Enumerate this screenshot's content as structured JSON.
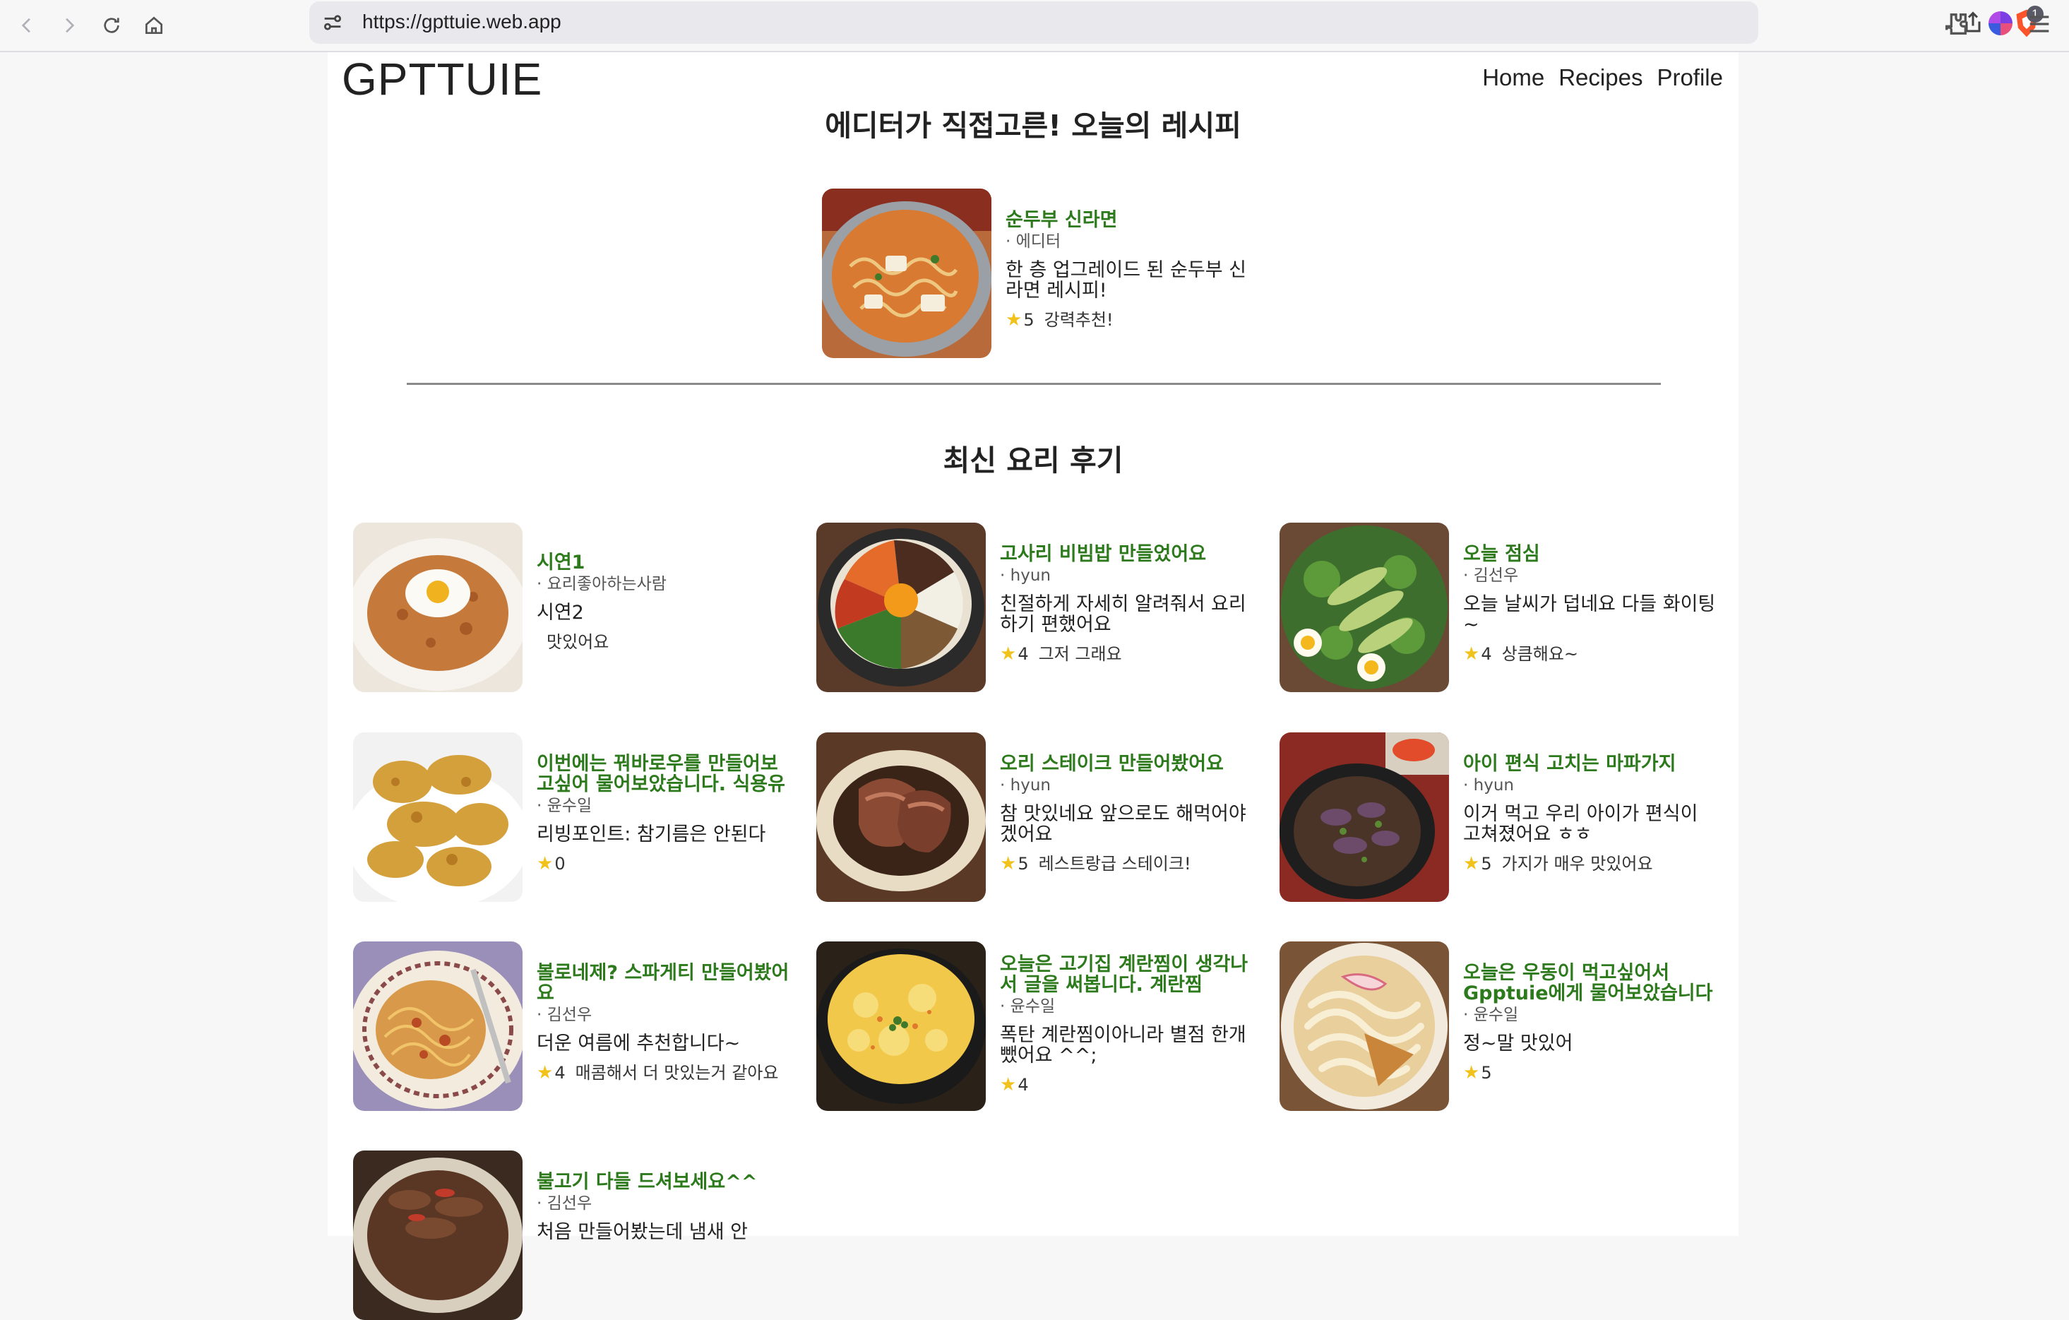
{
  "browser": {
    "url": "https://gpttuie.web.app",
    "badge_count": "1",
    "icons": [
      "back-icon",
      "forward-icon",
      "reload-icon",
      "home-icon",
      "site-settings-icon",
      "share-icon",
      "brave-shields-icon",
      "extensions-icon",
      "profile-icon",
      "menu-icon"
    ]
  },
  "site": {
    "logo": "GPTTUIE",
    "nav": [
      "Home",
      "Recipes",
      "Profile"
    ]
  },
  "featured": {
    "section_title": "에디터가 직접고른! 오늘의 레시피",
    "recipe": {
      "title": "순두부 신라면",
      "author": "에디터",
      "desc": "한 층 업그레이드 된 순두부 신라면 레시피!",
      "rating": "5",
      "comment": "강력추천!"
    }
  },
  "reviews": {
    "section_title": "최신 요리 후기",
    "items": [
      {
        "title": "시연1",
        "author": "요리좋아하는사람",
        "desc": "시연2",
        "rating": "",
        "comment": "맛있어요"
      },
      {
        "title": "고사리 비빔밥 만들었어요",
        "author": "hyun",
        "desc": "친절하게 자세히 알려줘서 요리하기 편했어요",
        "rating": "4",
        "comment": "그저 그래요"
      },
      {
        "title": "오늘 점심",
        "author": "김선우",
        "desc": "오늘 날씨가 덥네요 다들 화이팅~",
        "rating": "4",
        "comment": "상큼해요~"
      },
      {
        "title": "이번에는 꿔바로우를 만들어보고싶어 물어보았습니다. 식용유",
        "author": "윤수일",
        "desc": "리빙포인트: 참기름은 안된다",
        "rating": "0",
        "comment": ""
      },
      {
        "title": "오리 스테이크 만들어봤어요",
        "author": "hyun",
        "desc": "참 맛있네요 앞으로도 해먹어야겠어요",
        "rating": "5",
        "comment": "레스트랑급 스테이크!"
      },
      {
        "title": "아이 편식 고치는 마파가지",
        "author": "hyun",
        "desc": "이거 먹고 우리 아이가 편식이 고쳐졌어요 ㅎㅎ",
        "rating": "5",
        "comment": "가지가 매우 맛있어요"
      },
      {
        "title": "볼로네제? 스파게티 만들어봤어요",
        "author": "김선우",
        "desc": "더운 여름에 추천합니다~",
        "rating": "4",
        "comment": "매콤해서 더 맛있는거 같아요"
      },
      {
        "title": "오늘은 고기집 계란찜이 생각나서 글을 써봅니다. 계란찜",
        "author": "윤수일",
        "desc": "폭탄 계란찜이아니라 별점 한개 뺐어요 ^^;",
        "rating": "4",
        "comment": ""
      },
      {
        "title": "오늘은 우동이 먹고싶어서 Gpptuie에게 물어보았습니다",
        "author": "윤수일",
        "desc": "정~말 맛있어",
        "rating": "5",
        "comment": ""
      },
      {
        "title": "불고기 다들 드셔보세요^^",
        "author": "김선우",
        "desc": "처음 만들어봤는데 냄새 안",
        "rating": "",
        "comment": ""
      }
    ]
  },
  "colors": {
    "title_green": "#2d7a1d",
    "star": "#f1c21b",
    "page_bg": "#ffffff",
    "chrome_bg": "#f7f7f8"
  }
}
